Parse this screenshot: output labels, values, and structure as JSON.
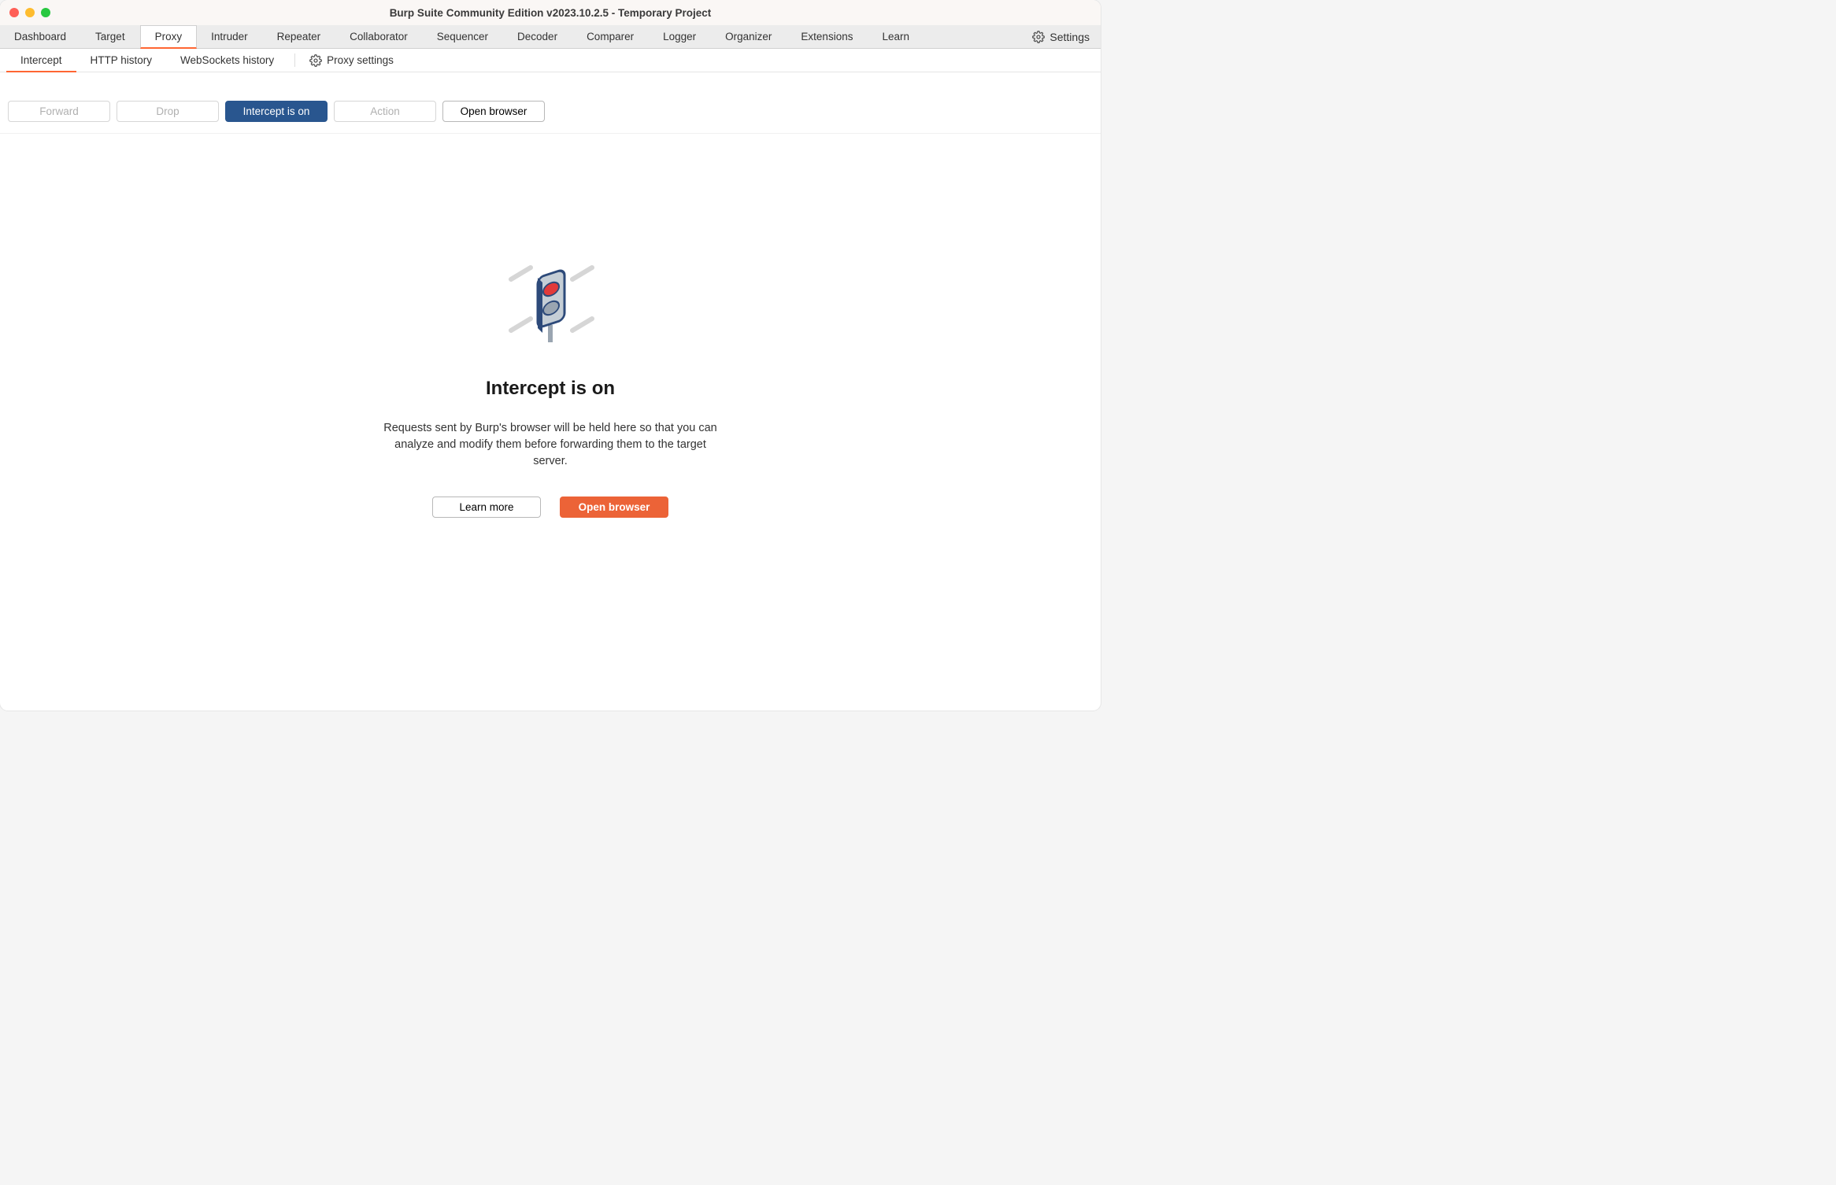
{
  "window": {
    "title": "Burp Suite Community Edition v2023.10.2.5 - Temporary Project"
  },
  "main_tabs": {
    "items": [
      "Dashboard",
      "Target",
      "Proxy",
      "Intruder",
      "Repeater",
      "Collaborator",
      "Sequencer",
      "Decoder",
      "Comparer",
      "Logger",
      "Organizer",
      "Extensions",
      "Learn"
    ],
    "active": "Proxy",
    "settings_label": "Settings"
  },
  "sub_tabs": {
    "items": [
      "Intercept",
      "HTTP history",
      "WebSockets history"
    ],
    "active": "Intercept",
    "proxy_settings_label": "Proxy settings"
  },
  "toolbar": {
    "forward_label": "Forward",
    "drop_label": "Drop",
    "intercept_label": "Intercept is on",
    "action_label": "Action",
    "open_browser_label": "Open browser"
  },
  "hero": {
    "title": "Intercept is on",
    "description": "Requests sent by Burp's browser will be held here so that you can analyze and modify them before forwarding them to the target server.",
    "learn_more_label": "Learn more",
    "open_browser_label": "Open browser"
  }
}
